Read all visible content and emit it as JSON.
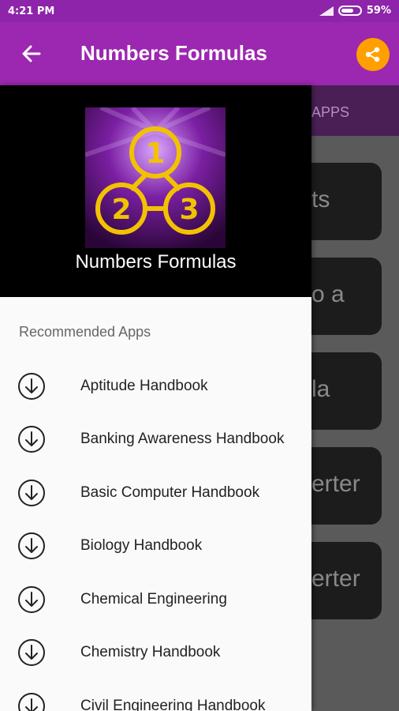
{
  "status_bar": {
    "time": "4:21 PM",
    "battery": "59%"
  },
  "app_bar": {
    "title": "Numbers Formulas"
  },
  "background": {
    "tab_label": "APPS",
    "cards": [
      "ts",
      "o a",
      "la",
      "erter",
      "erter"
    ]
  },
  "drawer": {
    "header_title": "Numbers Formulas",
    "logo_numbers": [
      "1",
      "2",
      "3"
    ],
    "section_label": "Recommended Apps",
    "items": [
      {
        "label": "Aptitude Handbook"
      },
      {
        "label": "Banking Awareness Handbook"
      },
      {
        "label": "Basic Computer Handbook"
      },
      {
        "label": "Biology Handbook"
      },
      {
        "label": "Chemical Engineering"
      },
      {
        "label": "Chemistry Handbook"
      },
      {
        "label": "Civil Engineering Handbook"
      }
    ]
  },
  "colors": {
    "status_bar": "#8e24aa",
    "app_bar": "#9c27b0",
    "share_button": "#ffa000",
    "logo_accent": "#f2c200"
  },
  "icons": {
    "back": "arrow-left-icon",
    "share": "share-icon",
    "item": "download-circle-icon"
  }
}
